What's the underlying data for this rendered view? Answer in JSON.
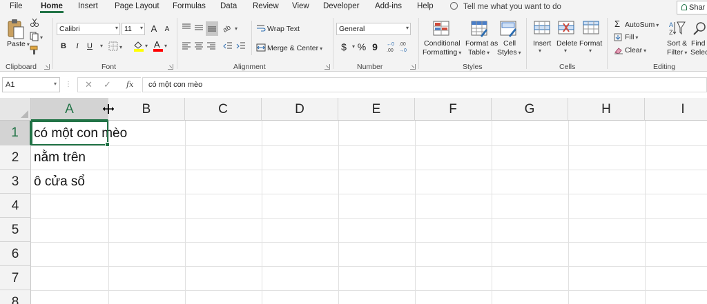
{
  "tabs": [
    "File",
    "Home",
    "Insert",
    "Page Layout",
    "Formulas",
    "Data",
    "Review",
    "View",
    "Developer",
    "Add-ins",
    "Help"
  ],
  "active_tab": "Home",
  "tell_me": "Tell me what you want to do",
  "share_label": "Shar",
  "groups": {
    "clipboard": "Clipboard",
    "font": "Font",
    "alignment": "Alignment",
    "number": "Number",
    "styles": "Styles",
    "cells": "Cells",
    "editing": "Editing"
  },
  "clipboard": {
    "paste": "Paste"
  },
  "font": {
    "name": "Calibri",
    "size": "11",
    "bold": "B",
    "italic": "I",
    "underline": "U",
    "grow": "A",
    "shrink": "A",
    "fill_letter": "A",
    "color_letter": "A"
  },
  "alignment": {
    "wrap": "Wrap Text",
    "merge": "Merge & Center"
  },
  "number": {
    "format": "General",
    "currency": "$",
    "percent": "%",
    "comma": "9"
  },
  "styles": {
    "conditional": [
      "Conditional",
      "Formatting"
    ],
    "format_table": [
      "Format as",
      "Table"
    ],
    "cell_styles": [
      "Cell",
      "Styles"
    ]
  },
  "cells": {
    "insert": "Insert",
    "delete": "Delete",
    "format": "Format"
  },
  "editing": {
    "autosum": "AutoSum",
    "fill": "Fill",
    "clear": "Clear",
    "sort": [
      "Sort &",
      "Filter"
    ],
    "find": [
      "Find",
      "Selec"
    ]
  },
  "formula_bar": {
    "name_box": "A1",
    "cancel": "✕",
    "enter": "✓",
    "fx": "fx",
    "content": "có một con mèo"
  },
  "columns": [
    "A",
    "B",
    "C",
    "D",
    "E",
    "F",
    "G",
    "H",
    "I"
  ],
  "selected_column": "A",
  "rows": [
    "1",
    "2",
    "3",
    "4",
    "5",
    "6",
    "7",
    "8"
  ],
  "selected_row": "1",
  "cells_data": [
    {
      "ref": "A1",
      "value": "có một con mèo"
    },
    {
      "ref": "A2",
      "value": "nằm trên"
    },
    {
      "ref": "A3",
      "value": "ô cửa sổ"
    }
  ],
  "colors": {
    "accent": "#217346",
    "fill_yellow": "#ffff00",
    "font_red": "#ff0000"
  },
  "icons": [
    "paste-icon",
    "cut-icon",
    "copy-icon",
    "format-painter-icon",
    "border-icon",
    "fill-color-icon",
    "font-color-icon",
    "align-top-icon",
    "align-middle-icon",
    "align-bottom-icon",
    "orientation-icon",
    "align-left-icon",
    "align-center-icon",
    "align-right-icon",
    "decrease-indent-icon",
    "increase-indent-icon",
    "wrap-text-icon",
    "merge-center-icon",
    "conditional-formatting-icon",
    "format-table-icon",
    "cell-styles-icon",
    "insert-cells-icon",
    "delete-cells-icon",
    "format-cells-icon",
    "autosum-icon",
    "fill-down-icon",
    "clear-icon",
    "sort-filter-icon",
    "find-select-icon",
    "lightbulb-icon",
    "column-resize-cursor-icon"
  ]
}
